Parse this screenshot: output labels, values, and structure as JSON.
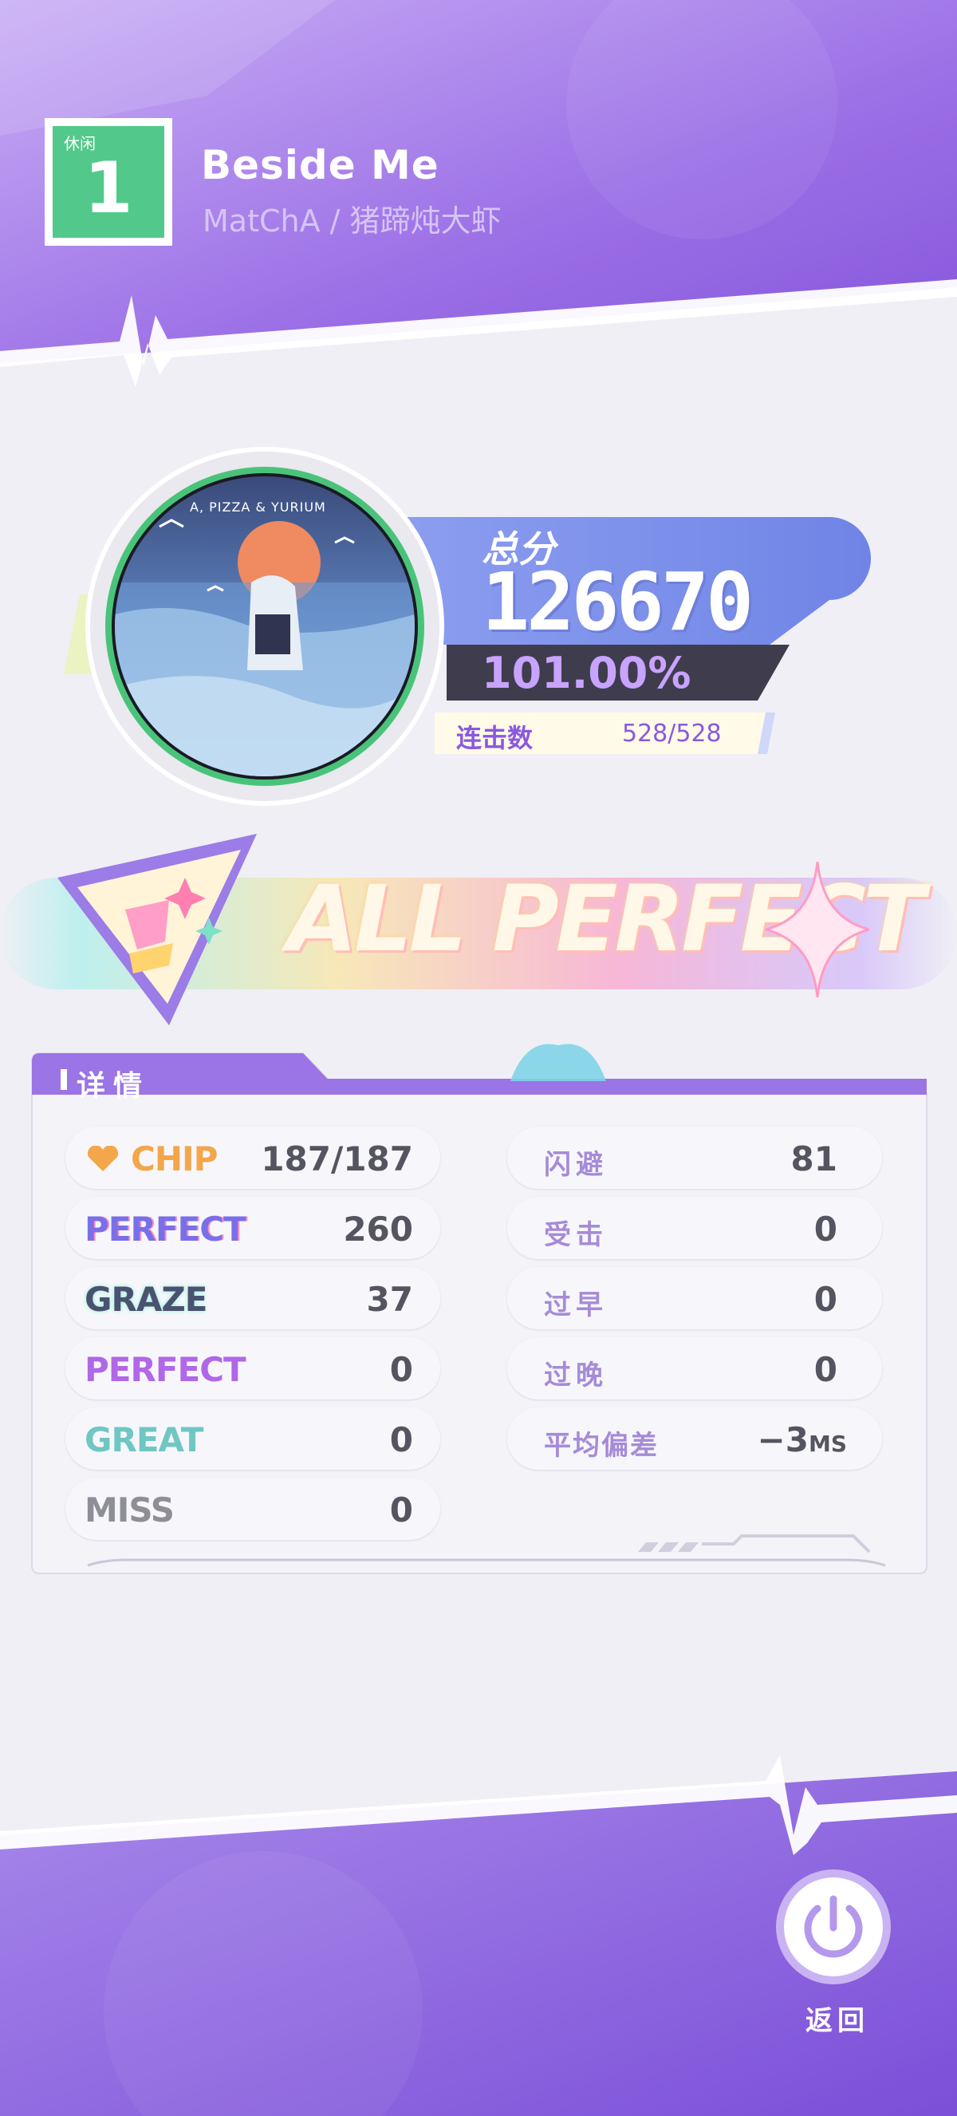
{
  "header": {
    "difficulty_label": "休闲",
    "level": "1",
    "title": "Beside Me",
    "artist": "MatChA / 猪蹄炖大虾"
  },
  "jacket": {
    "caption": "A, PIZZA & YURIUM"
  },
  "score": {
    "label": "总分",
    "value": "126670",
    "accuracy": "101.00%",
    "combo_label": "连击数",
    "combo_value": "528/528"
  },
  "banner": {
    "text": "ALL PERFECT"
  },
  "details": {
    "tab_label": "详情",
    "left_stats": [
      {
        "label": "CHIP",
        "value": "187/187",
        "style": "chip"
      },
      {
        "label": "PERFECT",
        "value": "260",
        "style": "rainbow"
      },
      {
        "label": "GRAZE",
        "value": "37",
        "style": "graze"
      },
      {
        "label": "PERFECT",
        "value": "0",
        "style": "purple"
      },
      {
        "label": "GREAT",
        "value": "0",
        "style": "teal"
      },
      {
        "label": "MISS",
        "value": "0",
        "style": "gray"
      }
    ],
    "right_stats": [
      {
        "label": "闪避",
        "value": "81"
      },
      {
        "label": "受击",
        "value": "0"
      },
      {
        "label": "过早",
        "value": "0"
      },
      {
        "label": "过晚",
        "value": "0"
      },
      {
        "label": "平均偏差",
        "value": "−3",
        "unit": "MS"
      }
    ]
  },
  "footer": {
    "back_label": "返回"
  },
  "colors": {
    "purple_dark": "#7b4fd9",
    "purple_light": "#a98be8",
    "score_blue": "#7b8ee8",
    "level_green": "#52c98a",
    "chip_orange": "#f4a64a"
  },
  "icons": {
    "chip": "heart-icon",
    "back": "power-icon",
    "emblem": "rank-emblem-icon",
    "sparkle": "sparkle-icon"
  }
}
